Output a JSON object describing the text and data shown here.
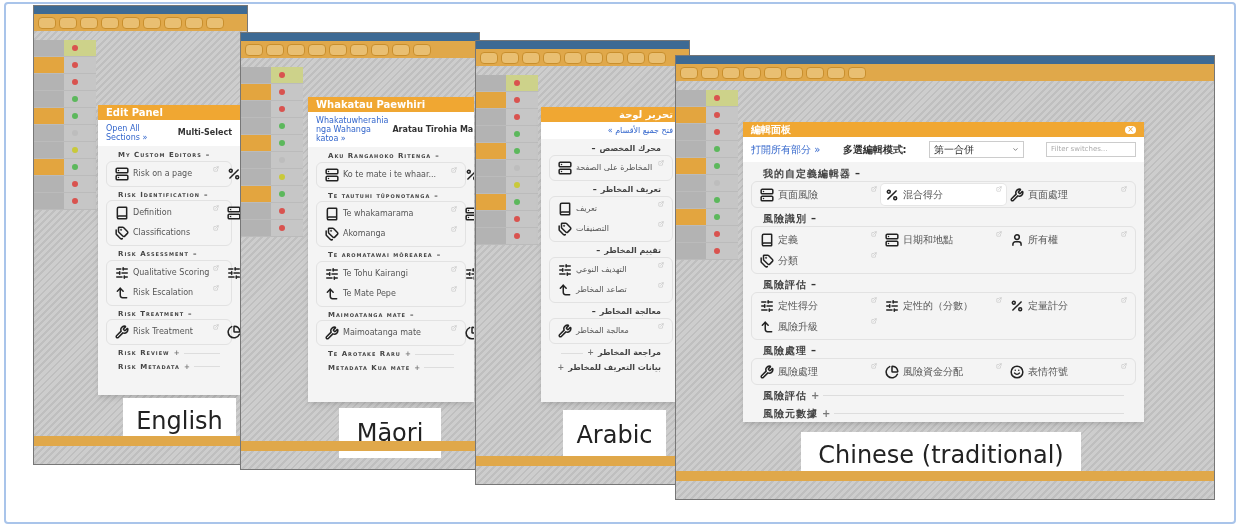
{
  "windows": [
    {
      "caption": "English",
      "rtl": false,
      "rows": [
        {
          "color": "#d9534f",
          "selected": false
        },
        {
          "color": "#d9534f",
          "selected": true
        },
        {
          "color": "#d9534f",
          "selected": false
        },
        {
          "color": "#5cb85c",
          "selected": false
        },
        {
          "color": "#5cb85c",
          "selected": true
        },
        {
          "color": "#bdbdbd",
          "selected": false
        },
        {
          "color": "#c9c93a",
          "selected": false
        },
        {
          "color": "#5cb85c",
          "selected": true
        },
        {
          "color": "#d9534f",
          "selected": false
        },
        {
          "color": "#d9534f",
          "selected": false
        }
      ],
      "panel": {
        "title": "Edit Panel",
        "open_all": "Open All Sections »",
        "multi_select": "Multi-Select",
        "sections": [
          {
            "title": "My Custom Editors",
            "toggle": "–",
            "expanded": true,
            "items": [
              {
                "kind": "page",
                "label": "Risk on a page",
                "selected": false
              },
              {
                "kind": "percent",
                "selected": false
              }
            ]
          },
          {
            "title": "Risk Identification",
            "toggle": "–",
            "expanded": true,
            "items": [
              {
                "kind": "book",
                "label": "Definition",
                "selected": false
              },
              {
                "kind": "page",
                "selected": false
              },
              {
                "kind": "tag",
                "label": "Classifications",
                "selected": false
              }
            ]
          },
          {
            "title": "Risk Assessment",
            "toggle": "–",
            "expanded": true,
            "items": [
              {
                "kind": "sliders",
                "label": "Qualitative Scoring",
                "selected": false
              },
              {
                "kind": "sliders",
                "selected": false
              },
              {
                "kind": "escalate",
                "label": "Risk Escalation",
                "selected": false
              }
            ]
          },
          {
            "title": "Risk Treatment",
            "toggle": "–",
            "expanded": true,
            "items": [
              {
                "kind": "wrench",
                "label": "Risk Treatment",
                "selected": false
              },
              {
                "kind": "pie",
                "selected": false
              }
            ]
          },
          {
            "title": "Risk Review",
            "toggle": "+",
            "expanded": false
          },
          {
            "title": "Risk Metadata",
            "toggle": "+",
            "expanded": false
          }
        ]
      }
    },
    {
      "caption": "Māori",
      "rtl": false,
      "rows": [
        {
          "color": "#d9534f",
          "selected": false
        },
        {
          "color": "#d9534f",
          "selected": true
        },
        {
          "color": "#d9534f",
          "selected": false
        },
        {
          "color": "#5cb85c",
          "selected": false
        },
        {
          "color": "#5cb85c",
          "selected": true
        },
        {
          "color": "#bdbdbd",
          "selected": false
        },
        {
          "color": "#c9c93a",
          "selected": false
        },
        {
          "color": "#5cb85c",
          "selected": true
        },
        {
          "color": "#d9534f",
          "selected": false
        },
        {
          "color": "#d9534f",
          "selected": false
        }
      ],
      "panel": {
        "title": "Whakatau Paewhiri",
        "open_all": "Whakatuwherahia nga Wahanga katoa »",
        "multi_select": "Aratau Tīrohia Ma",
        "sections": [
          {
            "title": "Aku Rangahoko Ritenga",
            "toggle": "–",
            "expanded": true,
            "items": [
              {
                "kind": "page",
                "label": "Ko te mate i te whaar...",
                "selected": false
              },
              {
                "kind": "percent",
                "selected": false
              }
            ]
          },
          {
            "title": "Te tautuhi tūponotanga",
            "toggle": "–",
            "expanded": true,
            "items": [
              {
                "kind": "book",
                "label": "Te whakamarama",
                "selected": false
              },
              {
                "kind": "page",
                "selected": false
              },
              {
                "kind": "tag",
                "label": "Akomanga",
                "selected": false
              }
            ]
          },
          {
            "title": "Te aromatawai mōrearea",
            "toggle": "–",
            "expanded": true,
            "items": [
              {
                "kind": "sliders",
                "label": "Te Tohu Kairangi",
                "selected": false
              },
              {
                "kind": "sliders",
                "selected": false
              },
              {
                "kind": "escalate",
                "label": "Te Mate Pepe",
                "selected": false
              }
            ]
          },
          {
            "title": "Maimoatanga mate",
            "toggle": "–",
            "expanded": true,
            "items": [
              {
                "kind": "wrench",
                "label": "Maimoatanga mate",
                "selected": false
              },
              {
                "kind": "pie",
                "selected": false
              }
            ]
          },
          {
            "title": "Te Arotake Raru",
            "toggle": "+",
            "expanded": false
          },
          {
            "title": "Metadata Kua mate",
            "toggle": "+",
            "expanded": false
          }
        ]
      }
    },
    {
      "caption": "Arabic",
      "rtl": true,
      "rows": [
        {
          "color": "#d9534f",
          "selected": false
        },
        {
          "color": "#d9534f",
          "selected": true
        },
        {
          "color": "#d9534f",
          "selected": false
        },
        {
          "color": "#5cb85c",
          "selected": false
        },
        {
          "color": "#5cb85c",
          "selected": true
        },
        {
          "color": "#bdbdbd",
          "selected": false
        },
        {
          "color": "#c9c93a",
          "selected": false
        },
        {
          "color": "#5cb85c",
          "selected": true
        },
        {
          "color": "#d9534f",
          "selected": false
        },
        {
          "color": "#d9534f",
          "selected": false
        }
      ],
      "panel": {
        "title": "تحرير لوحة",
        "open_all": "فتح جميع الأقسام »",
        "sections": [
          {
            "title": "محرك المخصص",
            "toggle": "–",
            "expanded": true,
            "items": [
              {
                "kind": "page",
                "label": "المخاطرة على الصفحة",
                "selected": false
              }
            ]
          },
          {
            "title": "تعريف المخاطر",
            "toggle": "–",
            "expanded": true,
            "items": [
              {
                "kind": "book",
                "label": "تعريف",
                "selected": false
              },
              {
                "kind": "tag",
                "label": "التصنيفات",
                "selected": false
              }
            ]
          },
          {
            "title": "تقييم المخاطر",
            "toggle": "–",
            "expanded": true,
            "items": [
              {
                "kind": "sliders",
                "label": "التهديف النوعي",
                "selected": false
              },
              {
                "kind": "escalate",
                "label": "تصاعد المخاطر",
                "selected": false
              }
            ]
          },
          {
            "title": "معالجة المخاطر",
            "toggle": "–",
            "expanded": true,
            "items": [
              {
                "kind": "wrench",
                "label": "معالجة المخاطر",
                "selected": false
              }
            ]
          },
          {
            "title": "مراجعة المخاطر",
            "toggle": "+",
            "expanded": false
          },
          {
            "title": "بيانات التعريف للمخاطر",
            "toggle": "+",
            "expanded": false
          }
        ]
      }
    },
    {
      "caption": "Chinese (traditional)",
      "rtl": false,
      "rows": [
        {
          "color": "#d9534f",
          "selected": false
        },
        {
          "color": "#d9534f",
          "selected": true
        },
        {
          "color": "#d9534f",
          "selected": false
        },
        {
          "color": "#5cb85c",
          "selected": false
        },
        {
          "color": "#5cb85c",
          "selected": true
        },
        {
          "color": "#bdbdbd",
          "selected": false
        },
        {
          "color": "#5cb85c",
          "selected": false
        },
        {
          "color": "#5cb85c",
          "selected": true
        },
        {
          "color": "#d9534f",
          "selected": false
        },
        {
          "color": "#d9534f",
          "selected": false
        }
      ],
      "panel": {
        "title": "編輯面板",
        "close": "×",
        "open_all": "打開所有部分 »",
        "multi_select": "多選編輯模式:",
        "mode": "第一合併",
        "filter_placeholder": "Filter switches...",
        "sections": [
          {
            "title": "我的自定義編輯器",
            "toggle": "–",
            "expanded": true,
            "items": [
              {
                "kind": "page",
                "label": "頁面風險",
                "selected": false
              },
              {
                "kind": "percent",
                "label": "混合得分",
                "selected": true
              },
              {
                "kind": "wrench",
                "label": "頁面處理",
                "selected": false
              }
            ]
          },
          {
            "title": "風險識別",
            "toggle": "–",
            "expanded": true,
            "items": [
              {
                "kind": "book",
                "label": "定義",
                "selected": false
              },
              {
                "kind": "page",
                "label": "日期和地點",
                "selected": false
              },
              {
                "kind": "user",
                "label": "所有權",
                "selected": false
              },
              {
                "kind": "tag",
                "label": "分類",
                "selected": false
              }
            ]
          },
          {
            "title": "風險評估",
            "toggle": "–",
            "expanded": true,
            "items": [
              {
                "kind": "sliders",
                "label": "定性得分",
                "selected": false
              },
              {
                "kind": "sliders",
                "label": "定性的（分數）",
                "selected": false
              },
              {
                "kind": "percent",
                "label": "定量計分",
                "selected": false
              },
              {
                "kind": "escalate",
                "label": "風險升級",
                "selected": false
              }
            ]
          },
          {
            "title": "風險處理",
            "toggle": "–",
            "expanded": true,
            "items": [
              {
                "kind": "wrench",
                "label": "風險處理",
                "selected": false
              },
              {
                "kind": "pie",
                "label": "風險資金分配",
                "selected": false
              },
              {
                "kind": "smile",
                "label": "表情符號",
                "selected": false
              }
            ]
          },
          {
            "title": "風險評估",
            "toggle": "+",
            "expanded": false
          },
          {
            "title": "風險元數據",
            "toggle": "+",
            "expanded": false
          }
        ]
      }
    }
  ]
}
